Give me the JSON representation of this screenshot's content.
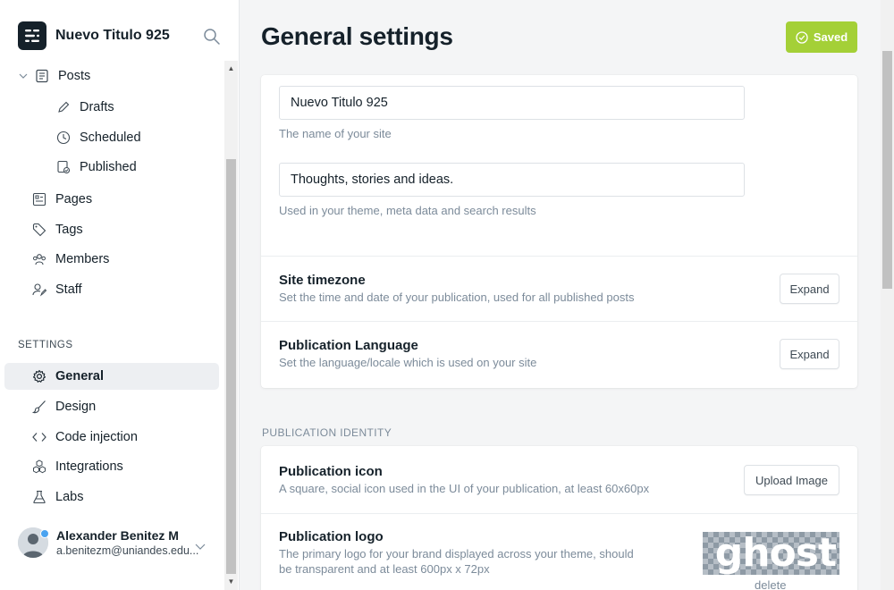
{
  "brand": {
    "name": "Nuevo Titulo 925",
    "logo_icon": "ghost-logo-icon"
  },
  "nav": {
    "posts": "Posts",
    "drafts": "Drafts",
    "scheduled": "Scheduled",
    "published": "Published",
    "pages": "Pages",
    "tags": "Tags",
    "members": "Members",
    "staff": "Staff",
    "settings_label": "SETTINGS",
    "general": "General",
    "design": "Design",
    "code_injection": "Code injection",
    "integrations": "Integrations",
    "labs": "Labs"
  },
  "user": {
    "name": "Alexander Benitez M",
    "email": "a.benitezm@uniandes.edu..."
  },
  "header": {
    "title": "General settings",
    "saved_label": "Saved"
  },
  "site": {
    "title_value": "Nuevo Titulo 925",
    "title_hint": "The name of your site",
    "description_value": "Thoughts, stories and ideas.",
    "description_hint": "Used in your theme, meta data and search results"
  },
  "timezone": {
    "title": "Site timezone",
    "desc": "Set the time and date of your publication, used for all published posts",
    "button": "Expand"
  },
  "language": {
    "title": "Publication Language",
    "desc": "Set the language/locale which is used on your site",
    "button": "Expand"
  },
  "identity": {
    "group_label": "PUBLICATION IDENTITY",
    "icon_title": "Publication icon",
    "icon_desc": "A square, social icon used in the UI of your publication, at least 60x60px",
    "upload_button": "Upload Image",
    "logo_title": "Publication logo",
    "logo_desc_1": "The primary logo for your brand displayed across your theme, should",
    "logo_desc_2": "be transparent and at least 600px x 72px",
    "logo_image_text": "ghost",
    "logo_delete": "delete"
  },
  "colors": {
    "accent_green": "#a4d037",
    "text_dark": "#15212a",
    "muted": "#7c8b9a",
    "active_bg": "#edeff2"
  }
}
